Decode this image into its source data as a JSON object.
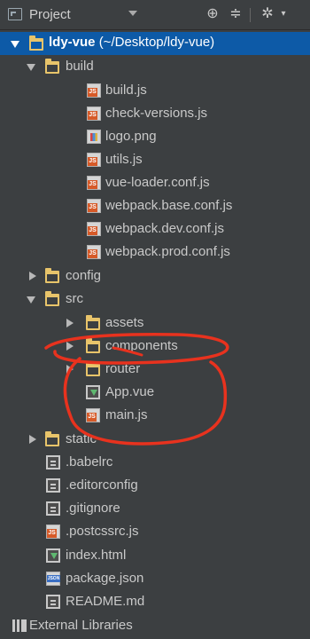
{
  "toolbar": {
    "title": "Project",
    "icons": [
      "project-view-icon",
      "chevron-down-icon",
      "target-icon",
      "collapse-icon",
      "gear-icon"
    ]
  },
  "tree": {
    "root": {
      "name": "ldy-vue",
      "path": "(~/Desktop/ldy-vue)"
    },
    "build": {
      "label": "build",
      "files": [
        "build.js",
        "check-versions.js",
        "logo.png",
        "utils.js",
        "vue-loader.conf.js",
        "webpack.base.conf.js",
        "webpack.dev.conf.js",
        "webpack.prod.conf.js"
      ]
    },
    "config": "config",
    "src": {
      "label": "src",
      "assets": "assets",
      "components": "components",
      "router": "router",
      "app": "App.vue",
      "main": "main.js"
    },
    "static": "static",
    "root_files": [
      ".babelrc",
      ".editorconfig",
      ".gitignore",
      ".postcssrc.js",
      "index.html",
      "package.json",
      "README.md"
    ],
    "external": "External Libraries"
  },
  "colors": {
    "selection": "#0d5aa7",
    "annotation": "#e8321e",
    "folder": "#e8c46a"
  }
}
